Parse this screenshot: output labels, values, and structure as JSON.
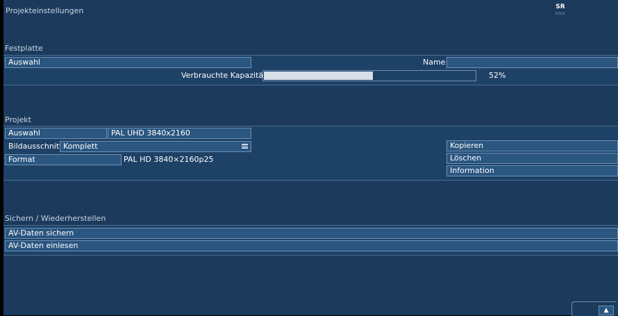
{
  "header": {
    "title": "Projekteinstellungen",
    "logo_main": "SR",
    "logo_sub": "ooo"
  },
  "festplatte": {
    "section_label": "Festplatte",
    "auswahl_label": "Auswahl",
    "name_label": "Name",
    "name_value": "",
    "capacity_label": "Verbrauchte Kapazität",
    "capacity_fraction": 0.52,
    "capacity_text": "52%"
  },
  "projekt": {
    "section_label": "Projekt",
    "auswahl_label": "Auswahl",
    "auswahl_value": "PAL UHD 3840x2160",
    "bildausschnitt_label": "Bildausschnitt",
    "bildausschnitt_value": "Komplett",
    "format_label": "Format",
    "format_value": "PAL HD 3840×2160p25",
    "kopieren_label": "Kopieren",
    "loeschen_label": "Löschen",
    "information_label": "Information"
  },
  "sichern": {
    "section_label": "Sichern / Wiederherstellen",
    "backup_label": "AV-Daten sichern",
    "restore_label": "AV-Daten einlesen"
  },
  "footer": {
    "home_icon": "house-icon"
  }
}
